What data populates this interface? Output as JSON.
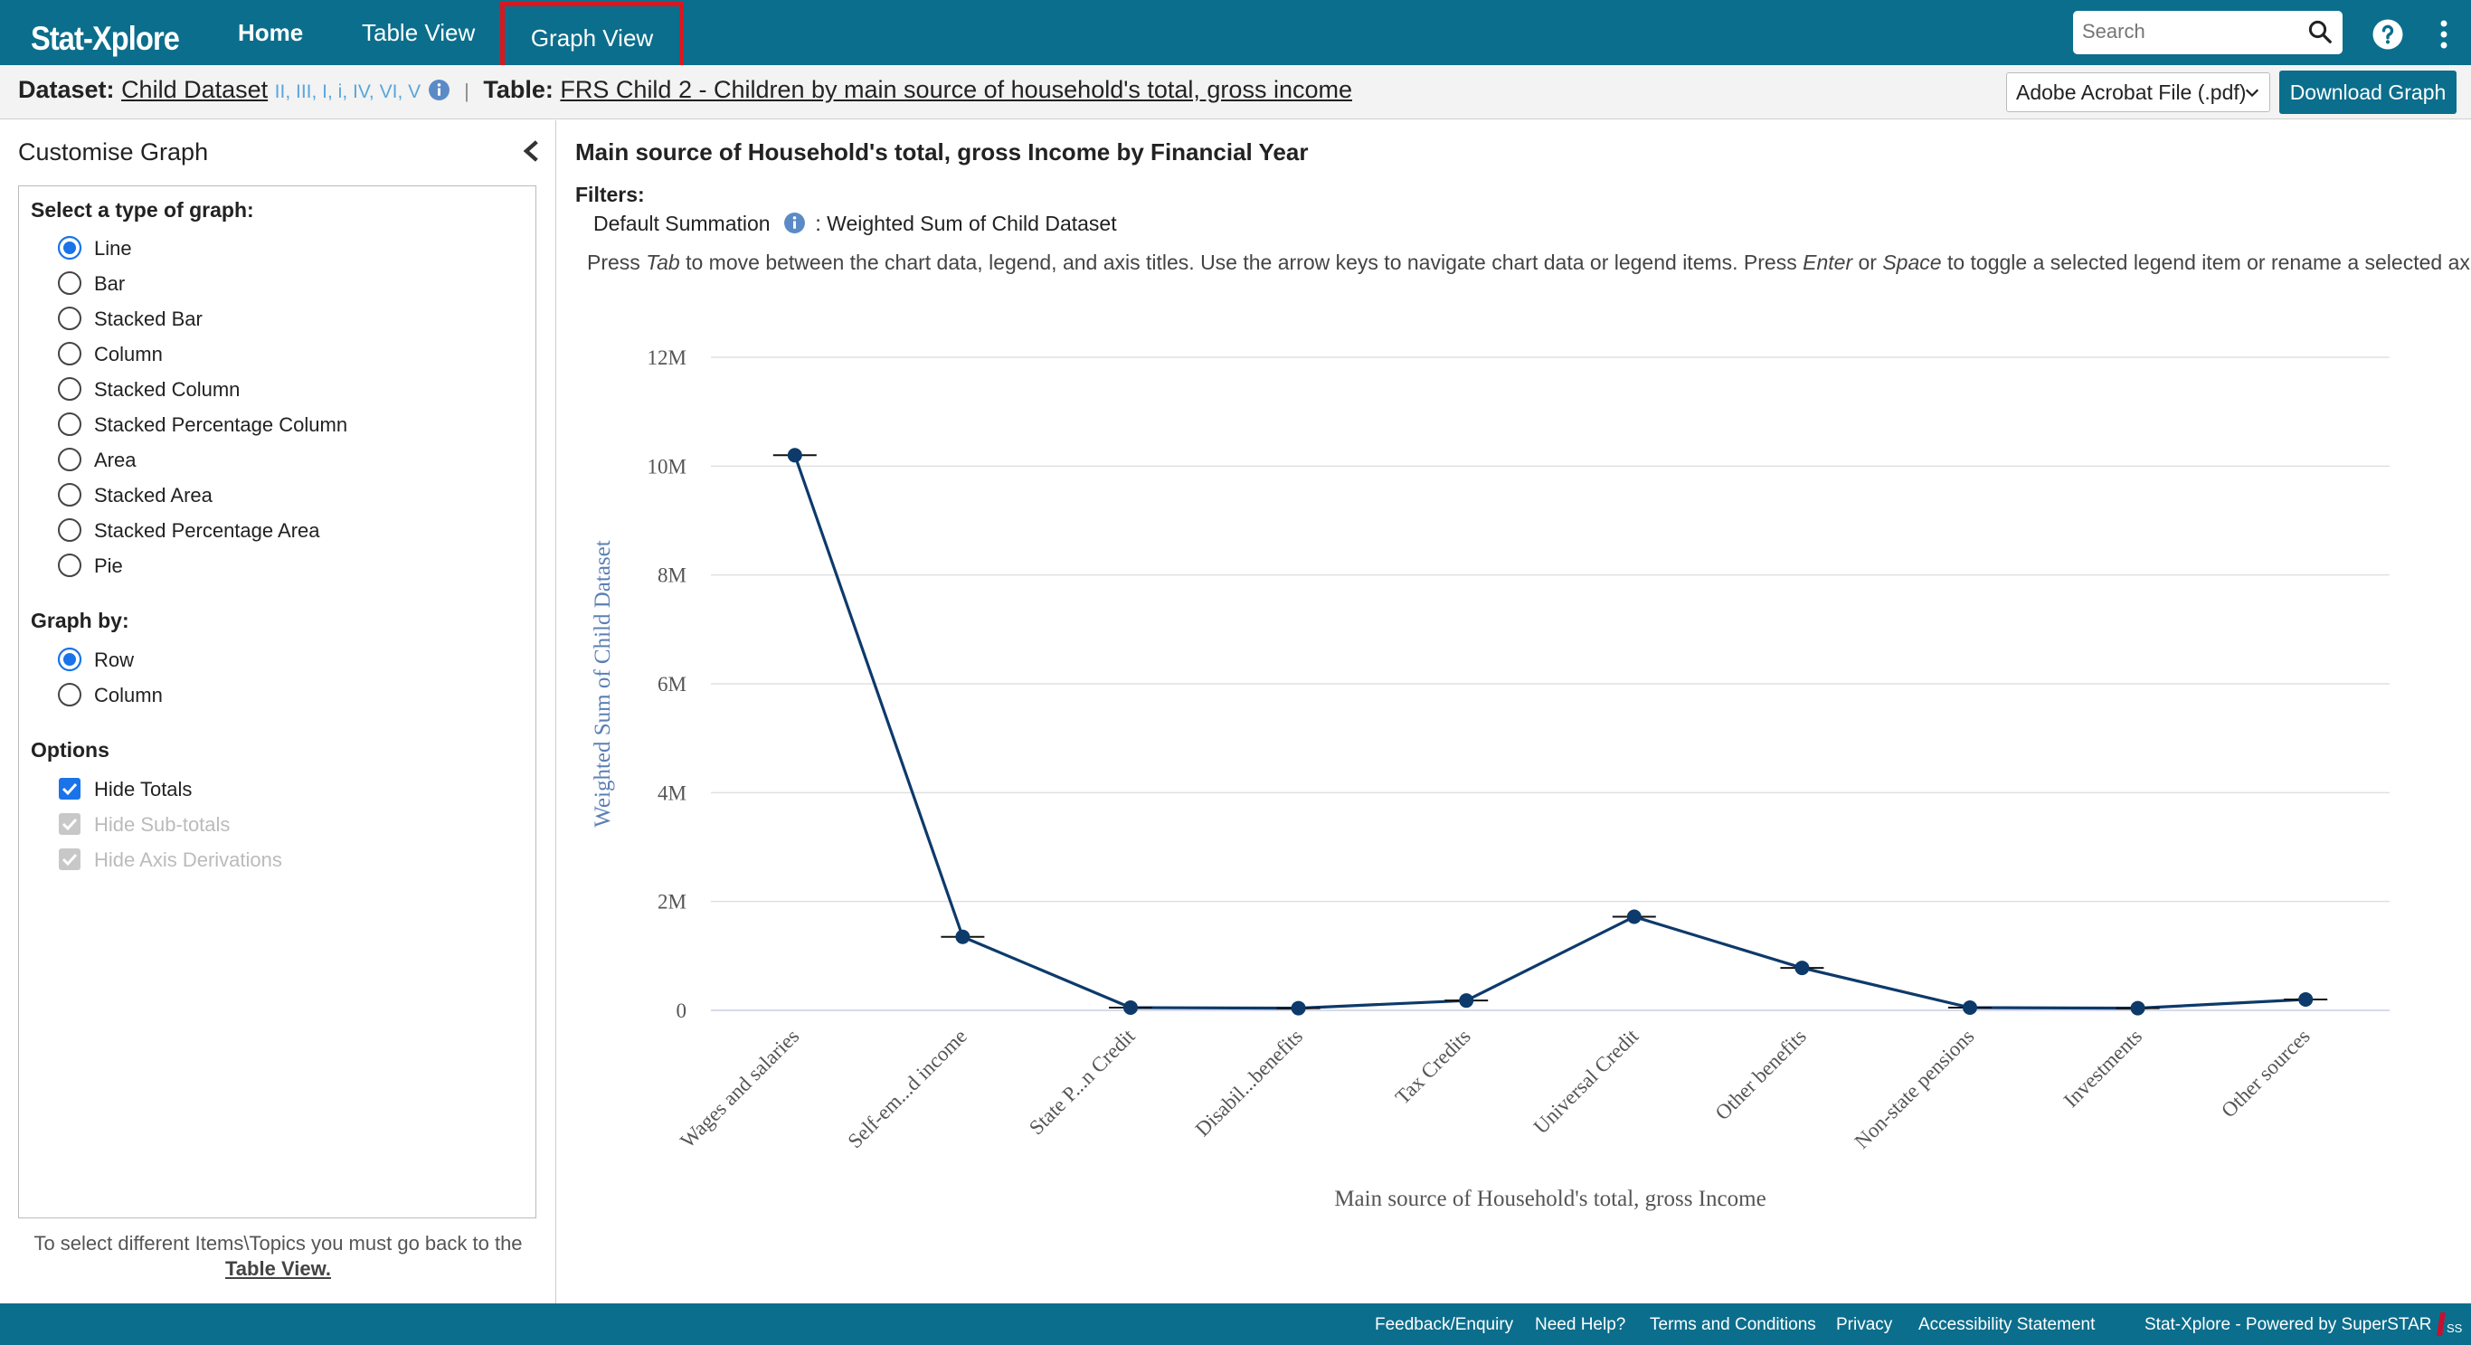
{
  "nav": {
    "brand": "Stat-Xplore",
    "home": "Home",
    "table_view": "Table View",
    "graph_view": "Graph View",
    "search_placeholder": "Search"
  },
  "dataset_bar": {
    "dataset_label": "Dataset:",
    "dataset_name": "Child Dataset",
    "dataset_versions": "II, III, I, i, IV, VI, V",
    "table_label": "Table:",
    "table_name": "FRS Child 2 - Children by main source of household's total, gross income",
    "format_selected": "Adobe Acrobat File (.pdf)",
    "download_label": "Download Graph"
  },
  "sidebar": {
    "title": "Customise Graph",
    "graph_type_label": "Select a type of graph:",
    "graph_types": [
      "Line",
      "Bar",
      "Stacked Bar",
      "Column",
      "Stacked Column",
      "Stacked Percentage Column",
      "Area",
      "Stacked Area",
      "Stacked Percentage Area",
      "Pie"
    ],
    "graph_type_selected": "Line",
    "graph_by_label": "Graph by:",
    "graph_by": [
      "Row",
      "Column"
    ],
    "graph_by_selected": "Row",
    "options_label": "Options",
    "options": [
      {
        "label": "Hide Totals",
        "checked": true,
        "disabled": false
      },
      {
        "label": "Hide Sub-totals",
        "checked": true,
        "disabled": true
      },
      {
        "label": "Hide Axis Derivations",
        "checked": true,
        "disabled": true
      }
    ],
    "footer_text": "To select different Items\\Topics you must go back to the",
    "footer_link": "Table View."
  },
  "main": {
    "title": "Main source of Household's total, gross Income by Financial Year",
    "filters_label": "Filters:",
    "filter_name": "Default Summation",
    "filter_value": ": Weighted Sum of Child Dataset",
    "hint_parts": [
      "Press ",
      "Tab",
      " to move between the chart data, legend, and axis titles. Use the arrow keys to navigate chart data or legend items. Press ",
      "Enter",
      " or ",
      "Space",
      " to toggle a selected legend item or rename a selected axis title."
    ]
  },
  "chart_data": {
    "type": "line",
    "title": "Main source of Household's total, gross Income by Financial Year",
    "xlabel": "Main source of Household's total, gross Income",
    "ylabel": "Weighted Sum of Child Dataset",
    "categories": [
      "Wages and salaries",
      "Self-em...d income",
      "State P...n Credit",
      "Disabil...benefits",
      "Tax Credits",
      "Universal Credit",
      "Other benefits",
      "Non-state pensions",
      "Investments",
      "Other sources"
    ],
    "series": [
      {
        "values": [
          10200000,
          1350000,
          50000,
          40000,
          180000,
          1720000,
          780000,
          50000,
          40000,
          200000
        ]
      }
    ],
    "ylim": [
      0,
      12000000
    ],
    "yticks": [
      0,
      2000000,
      4000000,
      6000000,
      8000000,
      10000000,
      12000000
    ],
    "ytick_labels": [
      "0",
      "2M",
      "4M",
      "6M",
      "8M",
      "10M",
      "12M"
    ],
    "grid": true,
    "legend": "none",
    "line_color": "#0d3a6b",
    "grid_color": "#e0e0e0"
  },
  "footer": {
    "links": [
      "Feedback/Enquiry",
      "Need Help?",
      "Terms and Conditions",
      "Privacy",
      "Accessibility Statement"
    ],
    "powered_by": "Stat-Xplore - Powered by SuperSTAR"
  }
}
